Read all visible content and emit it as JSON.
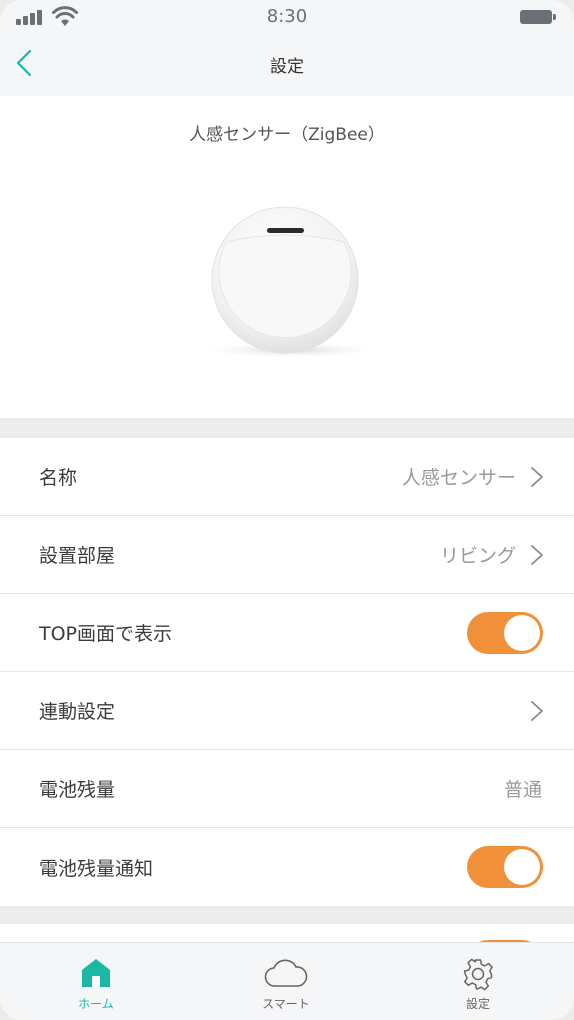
{
  "status_bar": {
    "time": "8:30"
  },
  "nav": {
    "title": "設定"
  },
  "device": {
    "name": "人感センサー（ZigBee）"
  },
  "settings": {
    "name": {
      "label": "名称",
      "value": "人感センサー"
    },
    "room": {
      "label": "設置部屋",
      "value": "リビング"
    },
    "top_display": {
      "label": "TOP画面で表示",
      "enabled": true
    },
    "linkage": {
      "label": "連動設定"
    },
    "battery": {
      "label": "電池残量",
      "value": "普通"
    },
    "battery_notify": {
      "label": "電池残量通知",
      "enabled": true
    }
  },
  "tabs": {
    "home": "ホーム",
    "smart": "スマート",
    "settings": "設定"
  },
  "colors": {
    "accent_teal": "#1bb8a6",
    "toggle_orange": "#f0913a",
    "back_arrow": "#1bb8a6"
  }
}
